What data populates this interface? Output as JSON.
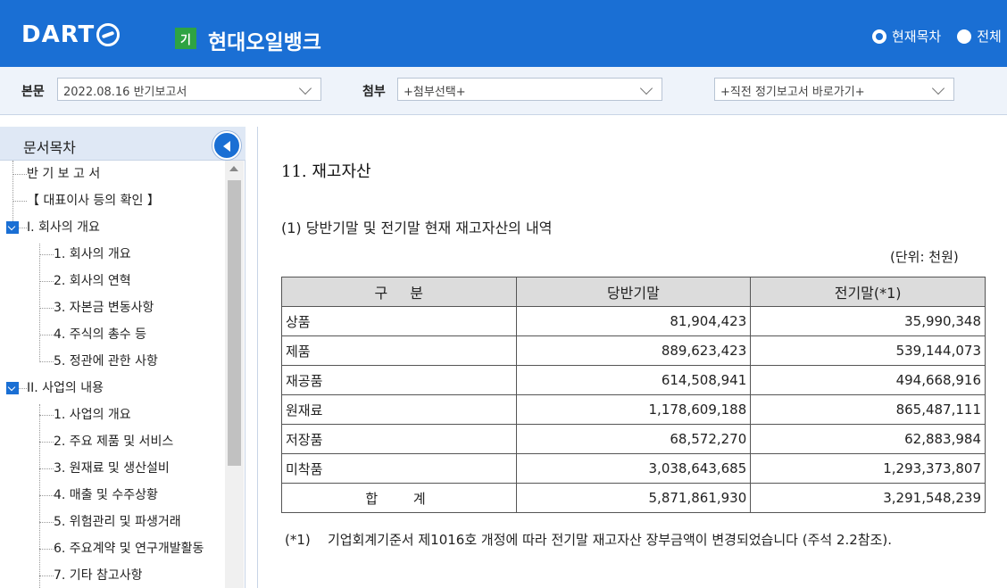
{
  "header": {
    "logo": "DART",
    "corp_badge": "기",
    "corp_name": "현대오일뱅크",
    "radio_current": "현재목차",
    "radio_all": "전체"
  },
  "toolbar": {
    "main_label": "본문",
    "main_select": "2022.08.16  반기보고서",
    "attach_label": "첨부",
    "attach_select": "+첨부선택+",
    "prev_select": "+직전 정기보고서 바로가기+"
  },
  "sidebar": {
    "title": "문서목차",
    "items": [
      {
        "label": "반 기 보 고 서",
        "level": 0
      },
      {
        "label": "【 대표이사 등의 확인 】",
        "level": 0
      },
      {
        "label": "I. 회사의 개요",
        "level": 0,
        "expandable": true
      },
      {
        "label": "1. 회사의 개요",
        "level": 1
      },
      {
        "label": "2. 회사의 연혁",
        "level": 1
      },
      {
        "label": "3. 자본금 변동사항",
        "level": 1
      },
      {
        "label": "4. 주식의 총수 등",
        "level": 1
      },
      {
        "label": "5. 정관에 관한 사항",
        "level": 1
      },
      {
        "label": "II. 사업의 내용",
        "level": 0,
        "expandable": true
      },
      {
        "label": "1. 사업의 개요",
        "level": 1
      },
      {
        "label": "2. 주요 제품 및 서비스",
        "level": 1
      },
      {
        "label": "3. 원재료 및 생산설비",
        "level": 1
      },
      {
        "label": "4. 매출 및 수주상황",
        "level": 1
      },
      {
        "label": "5. 위험관리 및 파생거래",
        "level": 1
      },
      {
        "label": "6. 주요계약 및 연구개발활동",
        "level": 1
      },
      {
        "label": "7. 기타 참고사항",
        "level": 1
      }
    ]
  },
  "content": {
    "section_title": "11. 재고자산",
    "sub_title": "(1) 당반기말 및 전기말 현재 재고자산의 내역",
    "unit": "(단위: 천원)",
    "table": {
      "headers": [
        "구  분",
        "당반기말",
        "전기말(*1)"
      ],
      "rows": [
        [
          "상품",
          "81,904,423",
          "35,990,348"
        ],
        [
          "제품",
          "889,623,423",
          "539,144,073"
        ],
        [
          "재공품",
          "614,508,941",
          "494,668,916"
        ],
        [
          "원재료",
          "1,178,609,188",
          "865,487,111"
        ],
        [
          "저장품",
          "68,572,270",
          "62,883,984"
        ],
        [
          "미착품",
          "3,038,643,685",
          "1,293,373,807"
        ]
      ],
      "total": [
        "합  계",
        "5,871,861,930",
        "3,291,548,239"
      ]
    },
    "note_mark": "(*1)",
    "note_text": "기업회계기준서 제1016호 개정에 따라 전기말 재고자산 장부금액이 변경되었습니다  (주석 2.2참조)."
  }
}
